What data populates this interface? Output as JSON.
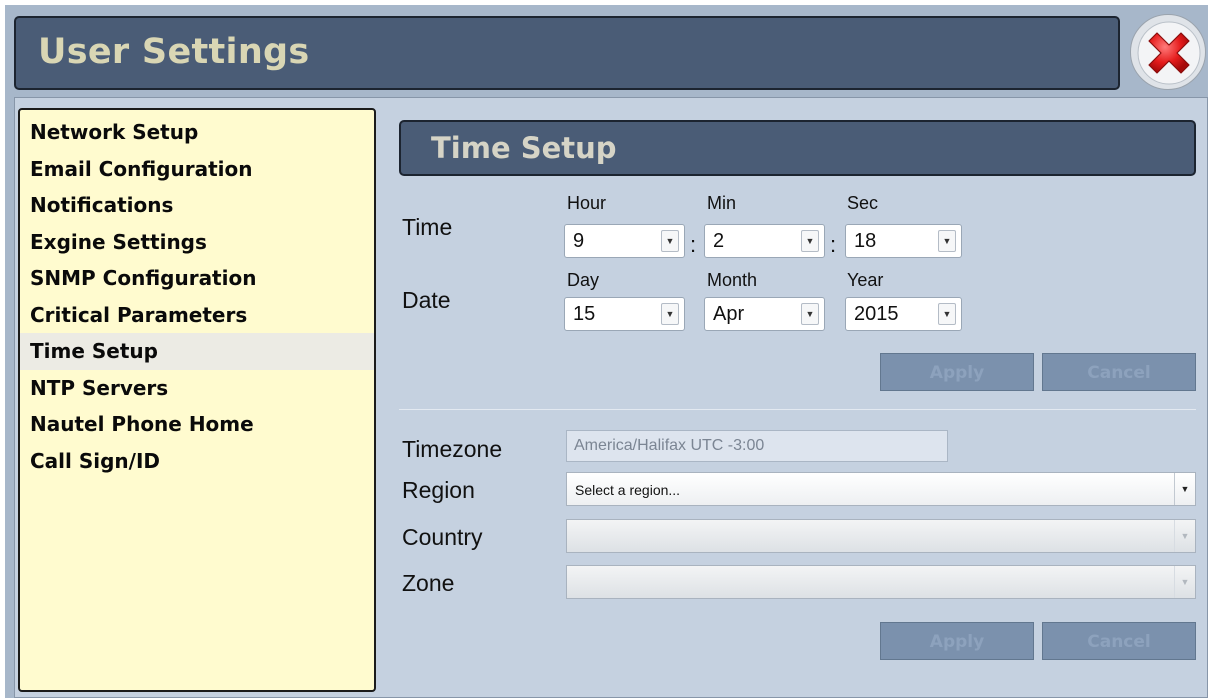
{
  "window": {
    "title": "User Settings",
    "close_icon": "close-x-icon",
    "accent_color": "#4a5c76",
    "sidebar_color": "#fffbcf",
    "panel_color": "#c5d1e0"
  },
  "sidebar": {
    "items": [
      {
        "label": "Network Setup"
      },
      {
        "label": "Email Configuration"
      },
      {
        "label": "Notifications"
      },
      {
        "label": "Exgine Settings"
      },
      {
        "label": "SNMP Configuration"
      },
      {
        "label": "Critical Parameters"
      },
      {
        "label": "Time Setup",
        "active": true
      },
      {
        "label": "NTP Servers"
      },
      {
        "label": "Nautel Phone Home"
      },
      {
        "label": "Call Sign/ID"
      }
    ]
  },
  "section": {
    "title": "Time Setup"
  },
  "time": {
    "label": "Time",
    "hour_label": "Hour",
    "min_label": "Min",
    "sec_label": "Sec",
    "hour": "9",
    "min": "2",
    "sec": "18",
    "separator": ":"
  },
  "date": {
    "label": "Date",
    "day_label": "Day",
    "month_label": "Month",
    "year_label": "Year",
    "day": "15",
    "month": "Apr",
    "year": "2015"
  },
  "datetime_buttons": {
    "apply": "Apply",
    "cancel": "Cancel"
  },
  "timezone": {
    "timezone_label": "Timezone",
    "timezone_value": "America/Halifax UTC -3:00",
    "region_label": "Region",
    "region_placeholder": "Select a region...",
    "country_label": "Country",
    "country_value": "",
    "zone_label": "Zone",
    "zone_value": ""
  },
  "timezone_buttons": {
    "apply": "Apply",
    "cancel": "Cancel"
  }
}
